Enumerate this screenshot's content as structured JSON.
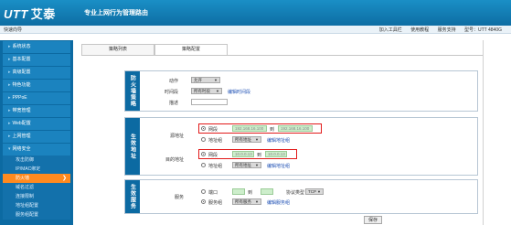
{
  "header": {
    "logo_mark": "UTT",
    "logo_name": "艾泰",
    "slogan": "专业上网行为管理路由"
  },
  "subbar": {
    "wizard": "快速向导",
    "links": [
      "加入工具栏",
      "使用教程",
      "服务支持",
      "型号：UTT 4840G"
    ]
  },
  "sidebar": {
    "items": [
      {
        "label": "系统状态"
      },
      {
        "label": "基本配置"
      },
      {
        "label": "高级配置"
      },
      {
        "label": "特色功能"
      },
      {
        "label": "PPPoE"
      },
      {
        "label": "带宽管理"
      },
      {
        "label": "Web配置"
      },
      {
        "label": "上网管理"
      },
      {
        "label": "网络安全"
      }
    ],
    "subitems": [
      {
        "label": "攻击防御"
      },
      {
        "label": "IP/MAC绑定"
      },
      {
        "label": "防火墙",
        "active": true
      },
      {
        "label": "域名过滤"
      },
      {
        "label": "连接限制"
      },
      {
        "label": "地址组配置"
      },
      {
        "label": "服务组配置"
      }
    ]
  },
  "tabs": [
    {
      "label": "策略列表"
    },
    {
      "label": "策略配置",
      "active": true
    }
  ],
  "policy": {
    "section_label": "防火墙策略",
    "action_label": "动作",
    "action_value": "允许",
    "time_label": "时间段",
    "time_value": "所有时段",
    "time_link": "编辑时间段",
    "desc_label": "描述"
  },
  "address": {
    "section_label": "生效地址",
    "src_label": "源地址",
    "dst_label": "目的地址",
    "range_label": "网段",
    "group_label": "地址组",
    "to_label": "到",
    "src_from": "192.168.16.100",
    "src_to": "192.168.16.100",
    "dst_from": "10.0.0.13",
    "dst_to": "10.0.0.13",
    "group_value": "所有地址",
    "group_link": "编辑地址组"
  },
  "service": {
    "section_label": "生效服务",
    "label": "服务",
    "port_label": "端口",
    "to_label": "到",
    "proto_label": "协议类型",
    "proto_value": "TCP",
    "group_label": "服务组",
    "group_value": "所有服务",
    "group_link": "编辑服务组"
  },
  "save_label": "保存",
  "colors": {
    "header": "#0d6da3",
    "sidebar": "#0c6aa2",
    "active": "#ff8a1f",
    "highlight": "#e21a1a",
    "ip_field": "#cdeecb"
  }
}
